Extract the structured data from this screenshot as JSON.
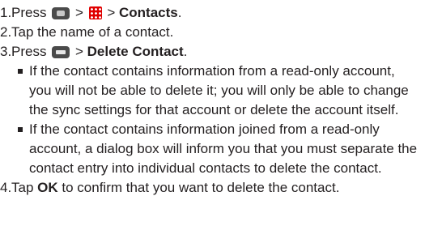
{
  "steps": [
    {
      "num": "1.",
      "pre": "Press",
      "sep1": ">",
      "sep2": ">",
      "target": "Contacts",
      "end": "."
    },
    {
      "num": "2.",
      "text": "Tap the name of a contact."
    },
    {
      "num": "3.",
      "pre": "Press",
      "sep": ">",
      "target": "Delete Contact",
      "end": "."
    },
    {
      "num": "4.",
      "pre": "Tap",
      "target": "OK",
      "post": "to confirm that you want to delete the contact."
    }
  ],
  "bullets": [
    "If the contact contains information from a read-only account, you will not be able to delete it; you will only be able to change the sync settings for that account or delete the account itself.",
    "If the contact contains information joined from a read-only account, a dialog box will inform you that you must separate the contact entry into individual contacts to delete the contact."
  ],
  "icons": {
    "home_key": "home-key-icon",
    "apps": "apps-grid-icon",
    "menu_key": "menu-key-icon"
  }
}
